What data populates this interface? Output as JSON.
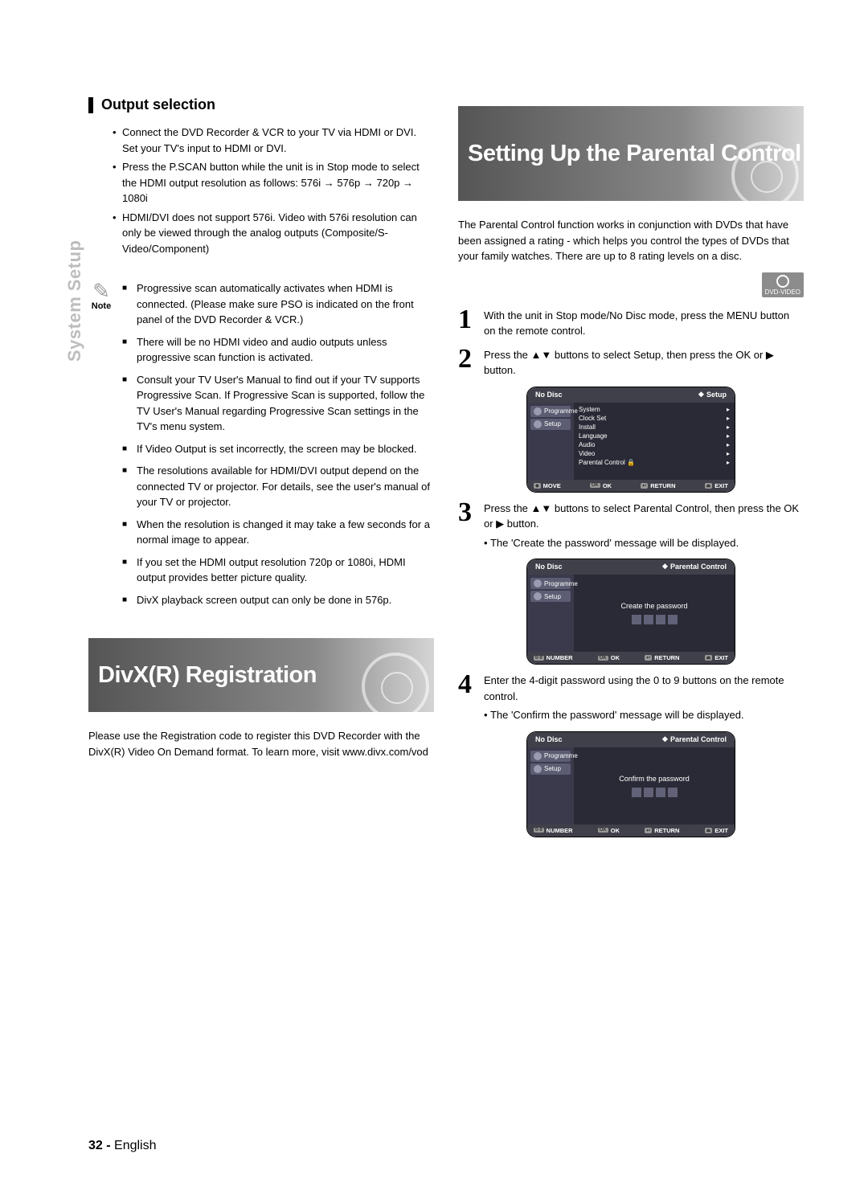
{
  "sideTab": "System Setup",
  "left": {
    "sectionTitle": "Output selection",
    "bullets": [
      "Connect the DVD Recorder & VCR to your TV via HDMI or DVI. Set your TV's input to HDMI or DVI.",
      "Press the P.SCAN button while the unit is in Stop mode to select the HDMI output resolution as follows: 576i → 576p → 720p → 1080i",
      "HDMI/DVI does not support 576i. Video with 576i resolution can only be viewed through the analog outputs (Composite/S-Video/Component)"
    ],
    "noteLabel": "Note",
    "notes": [
      "Progressive scan automatically activates when HDMI is connected. (Please make sure PSO is indicated on the front panel of the DVD Recorder & VCR.)",
      "There will be no HDMI video and audio outputs unless progressive scan function is activated.",
      "Consult your TV User's Manual to find out if your TV supports Progressive Scan. If Progressive Scan is supported, follow the TV User's Manual regarding Progressive Scan settings in the TV's menu system.",
      "If Video Output is set incorrectly, the screen may be blocked.",
      "The resolutions available for HDMI/DVI output depend on the connected TV or projector. For details, see the user's manual of your TV or projector.",
      "When the resolution is changed it may take a few seconds for a normal image to appear.",
      "If you set the HDMI output resolution 720p or 1080i, HDMI output provides better picture quality.",
      "DivX playback screen output can only be done in 576p."
    ],
    "divxBanner": "DivX(R) Registration",
    "divxPara": "Please use the Registration code to register this DVD Recorder with the DivX(R) Video On Demand format. To learn more, visit www.divx.com/vod"
  },
  "right": {
    "banner": "Setting Up the Parental Control",
    "intro": "The Parental Control function works in conjunction with DVDs that have been assigned a rating - which helps you control the types of DVDs that your family watches. There are up to 8 rating levels on a disc.",
    "dvdBadge": "DVD-VIDEO",
    "steps": {
      "s1": {
        "text": "With the unit in Stop mode/No Disc mode, press the MENU button on the remote control."
      },
      "s2": {
        "text": "Press the ▲▼ buttons to select Setup, then press the OK or ▶ button."
      },
      "s3": {
        "text": "Press the ▲▼ buttons to select Parental Control, then press the OK or ▶ button.",
        "sub": "The 'Create the password' message will be displayed."
      },
      "s4": {
        "text": "Enter the 4-digit password using the 0 to 9 buttons on the remote control.",
        "sub": "The 'Confirm the password' message will be displayed."
      }
    },
    "osd1": {
      "topLeft": "No Disc",
      "topRight": "❖  Setup",
      "sideItems": [
        "Programme",
        "Setup"
      ],
      "rows": [
        "System",
        "Clock Set",
        "Install",
        "Language",
        "Audio",
        "Video",
        "Parental Control    🔒"
      ],
      "bottom": {
        "move": "MOVE",
        "ok": "OK",
        "ret": "RETURN",
        "exit": "EXIT"
      }
    },
    "osd2": {
      "topLeft": "No Disc",
      "topRight": "❖  Parental Control",
      "sideItems": [
        "Programme",
        "Setup"
      ],
      "center": "Create the password",
      "bottom": {
        "num": "NUMBER",
        "ok": "OK",
        "ret": "RETURN",
        "exit": "EXIT"
      }
    },
    "osd3": {
      "topLeft": "No Disc",
      "topRight": "❖  Parental Control",
      "sideItems": [
        "Programme",
        "Setup"
      ],
      "center": "Confirm the password",
      "bottom": {
        "num": "NUMBER",
        "ok": "OK",
        "ret": "RETURN",
        "exit": "EXIT"
      }
    }
  },
  "footer": {
    "page": "32 -",
    "lang": "English"
  }
}
